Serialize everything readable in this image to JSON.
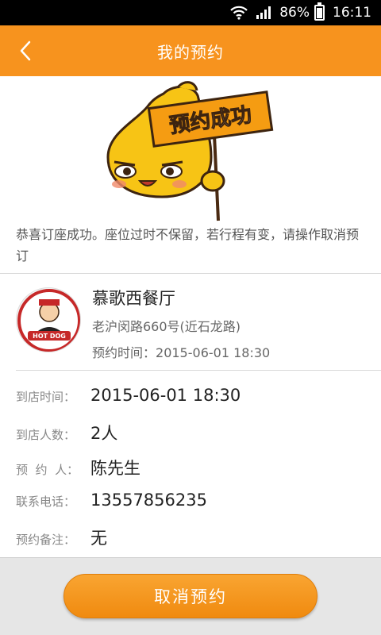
{
  "status_bar": {
    "battery_percent": "86%",
    "time": "16:11",
    "icons": [
      "wifi-icon",
      "signal-icon",
      "battery-icon"
    ]
  },
  "header": {
    "title": "我的预约",
    "back_icon": "chevron-left-icon"
  },
  "mascot": {
    "sign_text": "预约成功"
  },
  "notice": "恭喜订座成功。座位过时不保留，若行程有变，请操作取消预订",
  "restaurant": {
    "name": "慕歌西餐厅",
    "address": "老沪闵路660号(近石龙路)",
    "reserve_label": "预约时间：",
    "reserve_time": "2015-06-01  18:30",
    "logo_text": "HOT DOG"
  },
  "details": [
    {
      "label": "到店时间：",
      "value": "2015-06-01  18:30"
    },
    {
      "label": "到店人数：",
      "value": "2人"
    },
    {
      "label": "预  约  人：",
      "value": "陈先生"
    },
    {
      "label": "联系电话：",
      "value": "13557856235"
    },
    {
      "label": "预约备注：",
      "value": "无"
    }
  ],
  "actions": {
    "cancel_label": "取消预约"
  },
  "colors": {
    "accent": "#f7931e",
    "button": "#f39a1f",
    "bottom_bar": "#e6e6e6"
  }
}
